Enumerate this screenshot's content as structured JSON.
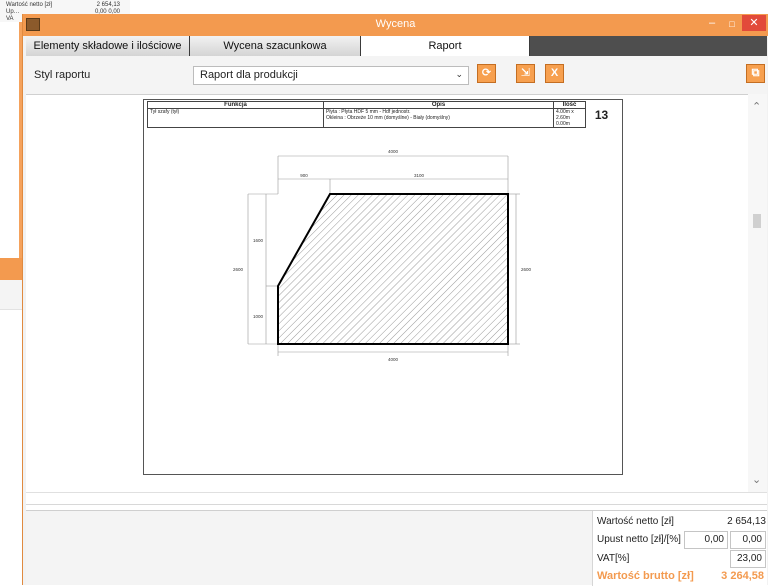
{
  "background": {
    "rows": [
      {
        "label": "Wartość netto [zł]",
        "value": "2 654,13"
      },
      {
        "label": "Up…",
        "value": "0,00   0,00"
      },
      {
        "label": "VA",
        "value": ""
      }
    ]
  },
  "window": {
    "title": "Wycena",
    "minimize": "–",
    "maximize": "□",
    "close": "✕"
  },
  "tabs": [
    "Elementy składowe i ilościowe",
    "Wycena szacunkowa",
    "Raport"
  ],
  "toolbar": {
    "style_label": "Styl raportu",
    "style_value": "Raport dla produkcji",
    "dropdown_icon": "⌄"
  },
  "report": {
    "headers": {
      "function": "Funkcja",
      "description": "Opis",
      "quantity": "Ilość"
    },
    "row": {
      "function": "Tył szafy (tył)",
      "desc_line1": "Płyta :  Płyta HDF 5 mm - Hdf jednostr.",
      "desc_line2": "Okleina :  Obrzeże 10 mm (domyślne) - Biały (domyślny)",
      "qty_line1": "4.00m x 2.60m",
      "qty_line2": "0.00m",
      "number": "13"
    },
    "dims": {
      "top_total": "4000",
      "top_left": "900",
      "top_right": "3100",
      "left_total": "2600",
      "left_upper": "1600",
      "left_lower": "1000",
      "right_total": "2600",
      "bottom_total": "4000"
    }
  },
  "summary": {
    "net_label": "Wartość netto [zł]",
    "net_value": "2 654,13",
    "discount_label": "Upust netto [zł]/[%]",
    "discount_value": "0,00",
    "discount_pct": "0,00",
    "vat_label": "VAT[%]",
    "vat_value": "23,00",
    "gross_label": "Wartość brutto [zł]",
    "gross_value": "3 264,58"
  },
  "colors": {
    "accent": "#f39a4f",
    "close": "#e24a3a"
  }
}
